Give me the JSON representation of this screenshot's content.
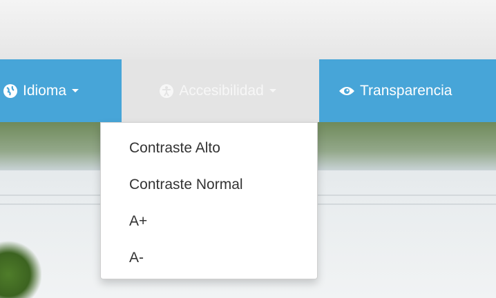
{
  "navbar": {
    "items": [
      {
        "label": "Idioma",
        "icon": "globe-icon"
      },
      {
        "label": "Accesibilidad",
        "icon": "accessibility-icon"
      },
      {
        "label": "Transparencia",
        "icon": "eye-icon"
      }
    ]
  },
  "dropdown": {
    "items": [
      {
        "label": "Contraste Alto"
      },
      {
        "label": "Contraste Normal"
      },
      {
        "label": "A+"
      },
      {
        "label": "A-"
      }
    ]
  },
  "colors": {
    "navbar_bg": "#47a5d8",
    "active_item_bg": "#e4e4e4",
    "menu_text": "#333333"
  }
}
